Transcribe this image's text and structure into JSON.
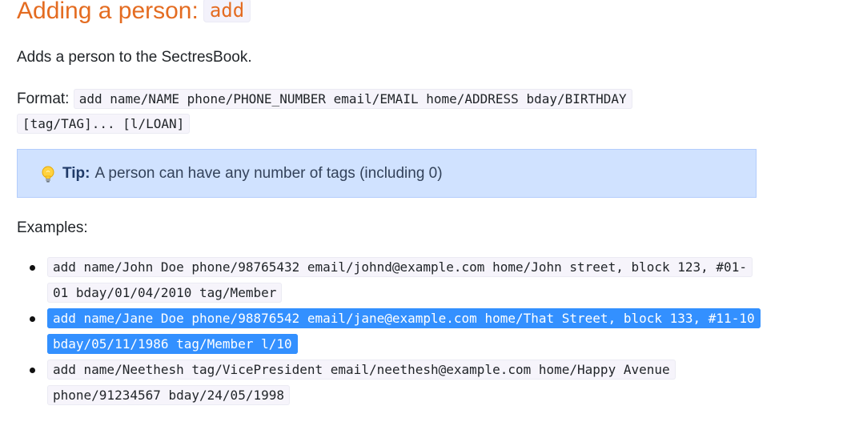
{
  "heading": {
    "title": "Adding a person:",
    "command": "add"
  },
  "intro": "Adds a person to the SectresBook.",
  "format": {
    "label": "Format:",
    "syntax": "add name/NAME phone/PHONE_NUMBER email/EMAIL home/ADDRESS bday/BIRTHDAY [tag/TAG]... [l/LOAN]"
  },
  "tip": {
    "icon": "lightbulb-icon",
    "label": "Tip:",
    "text": "A person can have any number of tags (including 0)"
  },
  "examples": {
    "label": "Examples:",
    "items": [
      {
        "text": "add name/John Doe phone/98765432 email/johnd@example.com home/John street, block 123, #01-01 bday/01/04/2010 tag/Member",
        "selected": false
      },
      {
        "text": "add name/Jane Doe phone/98876542 email/jane@example.com home/That Street, block 133, #11-10 bday/05/11/1986 tag/Member l/10",
        "selected": true
      },
      {
        "text": "add name/Neethesh tag/VicePresident email/neethesh@example.com home/Happy Avenue phone/91234567 bday/24/05/1998",
        "selected": false
      }
    ]
  },
  "colors": {
    "heading": "#e46c21",
    "tip_background": "#d0e2ff",
    "code_background": "#f6f4fb",
    "selection": "#3390ff"
  }
}
